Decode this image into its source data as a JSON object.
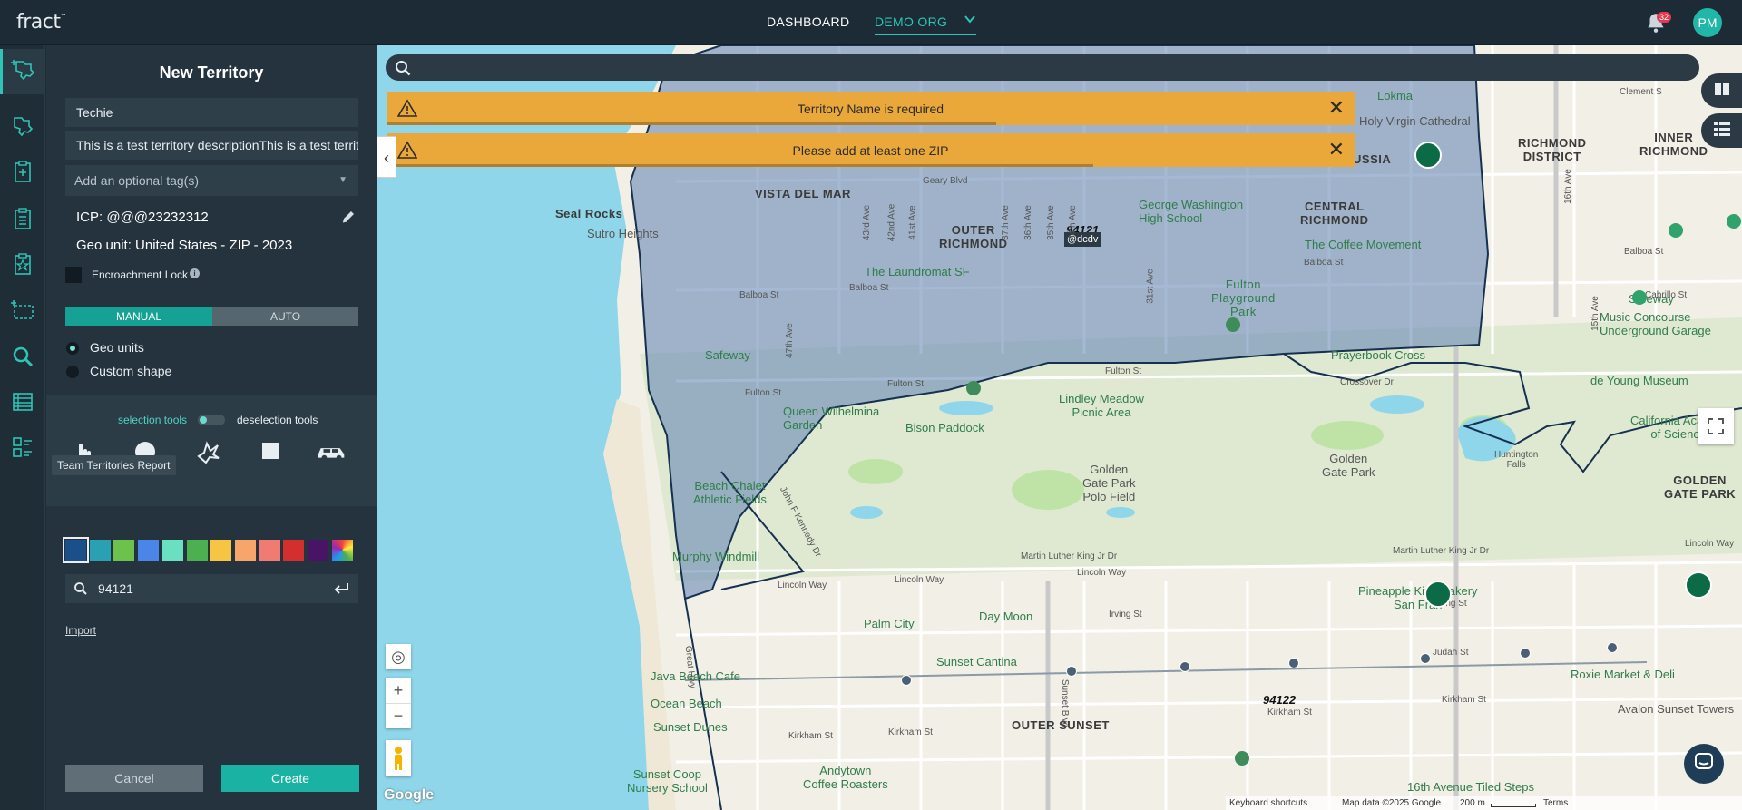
{
  "app": {
    "logo": "fract",
    "logo_tm": "™"
  },
  "topnav": {
    "dashboard": "DASHBOARD",
    "org": "DEMO ORG",
    "notif_count": "32",
    "avatar": "PM"
  },
  "rail": {
    "tooltip": "Team Territories Report"
  },
  "panel": {
    "title": "New Territory",
    "name_value": "Techie",
    "description_value": "This is a test territory descriptionThis is a test territory description",
    "tags_placeholder": "Add an optional tag(s)",
    "icp": "ICP: @@@23232312",
    "geo_unit": "Geo unit: United States - ZIP - 2023",
    "encroachment_lock": "Encroachment Lock",
    "mode_manual": "MANUAL",
    "mode_auto": "AUTO",
    "radio_geo_units": "Geo units",
    "radio_custom_shape": "Custom shape",
    "selection_tools": "selection tools",
    "deselection_tools": "deselection tools",
    "zip_search_value": "94121",
    "import": "Import",
    "cancel": "Cancel",
    "create": "Create"
  },
  "swatches": [
    "#1b4f8a",
    "#2aa1b3",
    "#6cc24a",
    "#4a86e8",
    "#6be0c0",
    "#4caf50",
    "#f6c544",
    "#f7a56b",
    "#f07b72",
    "#d32f2f",
    "#4a1466",
    "multicolor"
  ],
  "alerts": [
    {
      "message": "Territory Name is required",
      "progress": 0.63
    },
    {
      "message": "Please add at least one ZIP",
      "progress": 0.73
    }
  ],
  "map": {
    "labels": {
      "seal_rocks": "Seal Rocks",
      "sutro_heights": "Sutro Heights",
      "vista_del_mar": "VISTA DEL MAR",
      "outer_richmond": [
        "OUTER",
        "RICHMOND"
      ],
      "central_richmond": [
        "CENTRAL",
        "RICHMOND"
      ],
      "richmond_district": [
        "RICHMOND",
        "DISTRICT"
      ],
      "inner_richmond": [
        "INNER",
        "RICHMOND"
      ],
      "little_russia": "LITTLE RUSSIA",
      "lokma": "Lokma",
      "gw_high": [
        "George Washington",
        "High School"
      ],
      "coffee_movement": "The Coffee Movement",
      "laundromat": "The Laundromat SF",
      "fulton_playground": [
        "Fulton",
        "Playground",
        "Park"
      ],
      "safeway_left": "Safeway",
      "safeway_right": "Safeway",
      "queen_wilhelmina": [
        "Queen Wilhelmina",
        "Garden"
      ],
      "bison_paddock": "Bison Paddock",
      "lindley_meadow": [
        "Lindley Meadow",
        "Picnic Area"
      ],
      "golden_gate_park_polo": [
        "Golden",
        "Gate Park",
        "Polo Field"
      ],
      "golden_gate_park": [
        "Golden",
        "Gate Park"
      ],
      "golden_gate_park_right": [
        "GOLDEN",
        "GATE PARK"
      ],
      "beach_chalet": [
        "Beach Chalet",
        "Athletic Fields"
      ],
      "murphy_windmill": "Murphy Windmill",
      "music_concourse": [
        "Music Concourse",
        "Underground Garage"
      ],
      "de_young": "de Young Museum",
      "cal_academy": [
        "California Academy",
        "of Sciences"
      ],
      "huntington_falls": [
        "Huntington",
        "Falls"
      ],
      "prayerbook_cross": "Prayerbook Cross",
      "crossover_dr": "Crossover Dr",
      "pineapple_king": [
        "Pineapple King Bakery",
        "San Fran"
      ],
      "palm_city": "Palm City",
      "day_moon": "Day Moon",
      "sunset_cantina": "Sunset Cantina",
      "java_beach": "Java Beach Cafe",
      "roxie_market": "Roxie Market & Deli",
      "ocean_beach": "Ocean Beach",
      "sunset_dunes": "Sunset Dunes",
      "outer_sunset": "OUTER SUNSET",
      "andytown": [
        "Andytown",
        "Coffee Roasters"
      ],
      "sunset_coop": [
        "Sunset Coop",
        "Nursery School"
      ],
      "avalon": "Avalon Sunset Towers",
      "tiled_steps": "16th Avenue Tiled Steps",
      "zip_94121": "94121",
      "zip_94122": "94122",
      "dcdv": "@dcdv",
      "holy_virgin": "Holy Virgin Cathedral",
      "clement": "Clement S"
    },
    "streets": {
      "geary": "Geary Blvd",
      "balboa_1": "Balboa St",
      "balboa_2": "Balboa St",
      "balboa_3": "Balboa St",
      "balboa_4": "Balboa St",
      "fulton_1": "Fulton St",
      "fulton_2": "Fulton St",
      "fulton_3": "Fulton St",
      "cabrillo": "Cabrillo St",
      "lincoln_1": "Lincoln Way",
      "lincoln_2": "Lincoln Way",
      "lincoln_3": "Lincoln Way",
      "lincoln_4": "Lincoln Way",
      "irving_1": "Irving St",
      "irving_2": "Irving St",
      "judah": "Judah St",
      "kirkham_1": "Kirkham St",
      "kirkham_2": "Kirkham St",
      "kirkham_3": "Kirkham St",
      "kirkham_4": "Kirkham St",
      "mlk_1": "Martin Luther King Jr Dr",
      "mlk_2": "Martin Luther King Jr Dr",
      "jfk": "John F Kennedy Dr",
      "great_hwy": "Great Hwy",
      "sunset_blvd": "Sunset Blvd",
      "ave_43": "43rd Ave",
      "ave_42": "42nd Ave",
      "ave_41": "41st Ave",
      "ave_37": "37th Ave",
      "ave_36": "36th Ave",
      "ave_35": "35th Ave",
      "ave_34": "34th Ave",
      "ave_31": "31st Ave",
      "ave_47": "47th Ave",
      "ave_16": "16th Ave",
      "ave_15": "15th Ave"
    },
    "footer": {
      "shortcuts": "Keyboard shortcuts",
      "mapdata": "Map data ©2025 Google",
      "scale": "200 m",
      "terms": "Terms"
    },
    "google": "Google"
  },
  "colors": {
    "accent": "#2ec4b6",
    "alert": "#eba83a",
    "territory_fill": "#5b7fb0",
    "water": "#8fd6ea"
  }
}
